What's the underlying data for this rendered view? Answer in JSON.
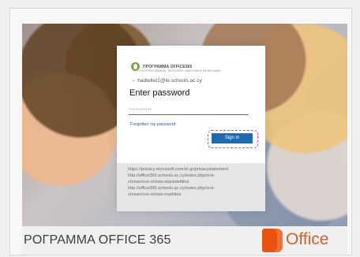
{
  "page": {
    "brand_line_1": "ΠΡΟΓΡΑΜΜΑ OFFICE365",
    "brand_line_2": "ΥΠΟΥΡΓΕΙΟ ΠΑΙΔΕΙΑΣ, ΠΟΛΙΤΙΣΜΟΥ, ΑΘΛΗΤΙΣΜΟΥ ΚΑΙ ΝΕΟΛΑΙΑΣ",
    "email": "← hadteltet1@te.schools.ac.cy",
    "title": "Enter password",
    "password_value": "···········",
    "forgot_password": "Forgotten my password",
    "sign_in": "Sign in",
    "info_lines": [
      "https://privacy.microsoft.com/el-gr/privacystatement",
      "http://office365.schools.ac.cy/index.php/oroi-",
      "chrisis/oroi-chrisis-ekpaideftikoi",
      "http://office365.schools.ac.cy/index.php/oroi-",
      "chrisis/oroi-chrisis-mathites"
    ],
    "bottom_banner": "ΡΟΓΡΑΜΜΑ OFFICE 365",
    "office_text": "Office"
  }
}
